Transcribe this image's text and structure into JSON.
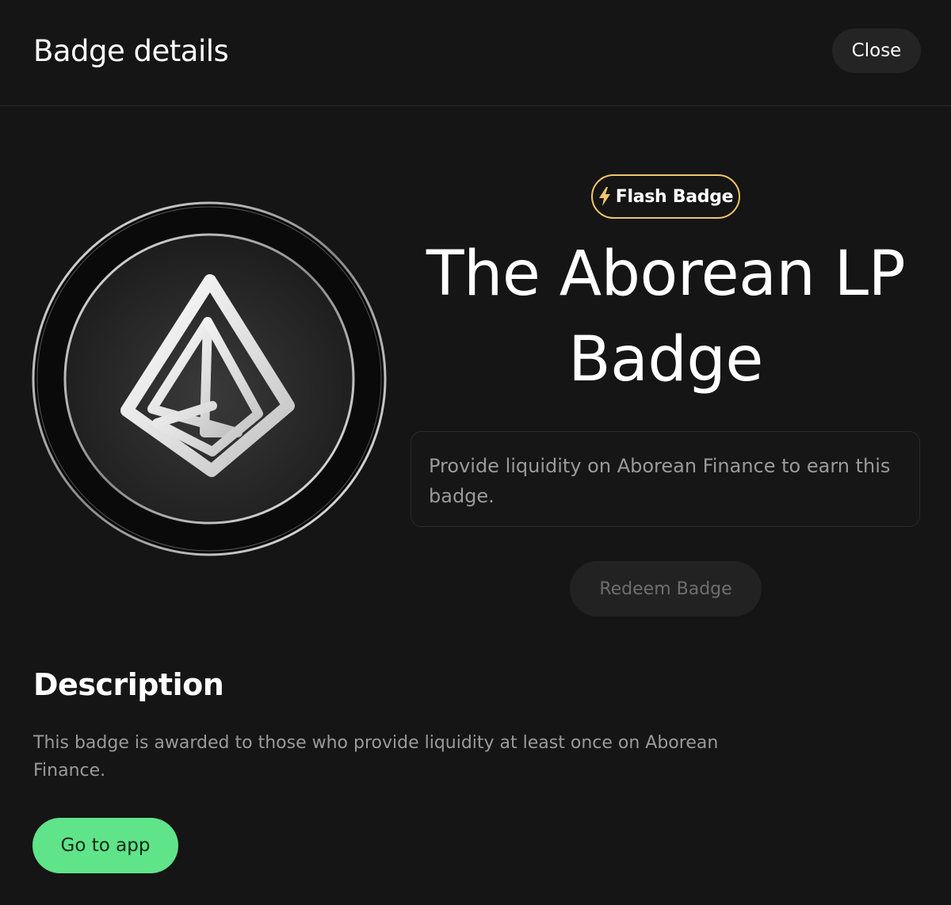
{
  "header": {
    "title": "Badge details",
    "close_label": "Close"
  },
  "badge": {
    "type_label": "Flash Badge",
    "type_icon": "lightning-bolt-icon",
    "type_color": "#f0c66a",
    "title": "The Aborean LP Badge",
    "hint": "Provide liquidity on Aborean Finance to earn this badge.",
    "redeem_label": "Redeem Badge",
    "image_icon": "aborean-logo-icon"
  },
  "description": {
    "heading": "Description",
    "text": "This badge is awarded to those who provide liquidity at least once on Aborean Finance.",
    "cta_label": "Go to app",
    "cta_color": "#5fe48a"
  }
}
